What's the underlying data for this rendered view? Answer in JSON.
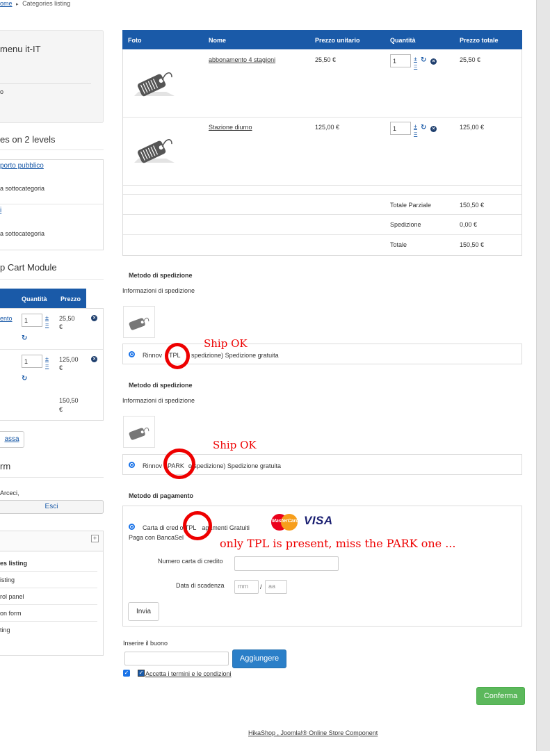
{
  "breadcrumb": {
    "home": "ome",
    "separator": "▸",
    "current": "Categories listing"
  },
  "left": {
    "menu_title": "menu it-IT",
    "menu_small": "o",
    "categories_title": "es on 2 levels",
    "cat1_link": "porto pubblico",
    "cat1_sub": "a sottocategoria",
    "cat2_link": "i",
    "cat2_sub": "a sottocategoria",
    "cart_module_title": "p Cart Module",
    "mini_cart": {
      "col_qty": "Quantità",
      "col_price": "Prezzo",
      "items": [
        {
          "name": "ento",
          "qty": "1",
          "price": "25,50",
          "currency": "€"
        },
        {
          "name": "",
          "qty": "1",
          "price": "125,00",
          "currency": "€"
        }
      ],
      "total": "150,50",
      "total_currency": "€"
    },
    "checkout_link": "assa",
    "form_title": "rm",
    "greeting": "Arceci,",
    "logout_button": "Esci",
    "menu_items": [
      {
        "label": "es listing",
        "bold": true
      },
      {
        "label": "isting",
        "bold": false
      },
      {
        "label": "rol panel",
        "bold": false
      },
      {
        "label": "on form",
        "bold": false
      },
      {
        "label": "ting",
        "bold": false
      }
    ],
    "plus_symbol": "+"
  },
  "cart": {
    "headers": [
      "Foto",
      "Nome",
      "Prezzo unitario",
      "Quantità",
      "Prezzo totale"
    ],
    "rows": [
      {
        "name": "abbonamento 4 stagioni",
        "unit_price": "25,50 €",
        "qty": "1",
        "total": "25,50 €"
      },
      {
        "name": "Stazione diurno",
        "unit_price": "125,00 €",
        "qty": "1",
        "total": "125,00 €"
      }
    ],
    "subtotal_label": "Totale Parziale",
    "subtotal_value": "150,50 €",
    "shipping_label": "Spedizione",
    "shipping_value": "0,00 €",
    "total_label": "Totale",
    "total_value": "150,50 €",
    "plus": "±",
    "minus": "="
  },
  "shipping1": {
    "title": "Metodo di spedizione",
    "info": "Informazioni di spedizione",
    "option_pre": "Rinnov",
    "option_tag": "TPL",
    "option_post": "o spedizione) Spedizione gratuita"
  },
  "shipping2": {
    "title": "Metodo di spedizione",
    "info": "Informazioni di spedizione",
    "option_pre": "Rinnov",
    "option_tag": "PARK",
    "option_post": "o spedizione) Spedizione gratuita"
  },
  "payment": {
    "title": "Metodo di pagamento",
    "option_pre": "Carta di cred",
    "option_tag": "o TPL",
    "option_post": "agamenti Gratuiti",
    "subline": "Paga con BancaSel",
    "card_number_label": "Numero carta di credito",
    "expiry_label": "Data di scadenza",
    "mm_placeholder": "mm",
    "slash": "/",
    "yy_placeholder": "aa",
    "submit_button": "Invia",
    "mastercard_text": "MasterCard",
    "visa_text": "VISA"
  },
  "coupon": {
    "label": "Inserire il buono",
    "button": "Aggiungere",
    "terms_link": "Accetta i termini e le condizioni",
    "check_mark": "✓"
  },
  "confirm_button": "Conferma",
  "footer_link": "HikaShop , Joomla!® Online Store Component",
  "annotations": {
    "ship_ok_1": "Ship OK",
    "ship_ok_2": "Ship OK",
    "note": "only TPL is present, miss the PARK one ..."
  },
  "colors": {
    "header_blue": "#1a5aa8",
    "confirm_green": "#5cb85c",
    "annotation_red": "#ee0000"
  }
}
